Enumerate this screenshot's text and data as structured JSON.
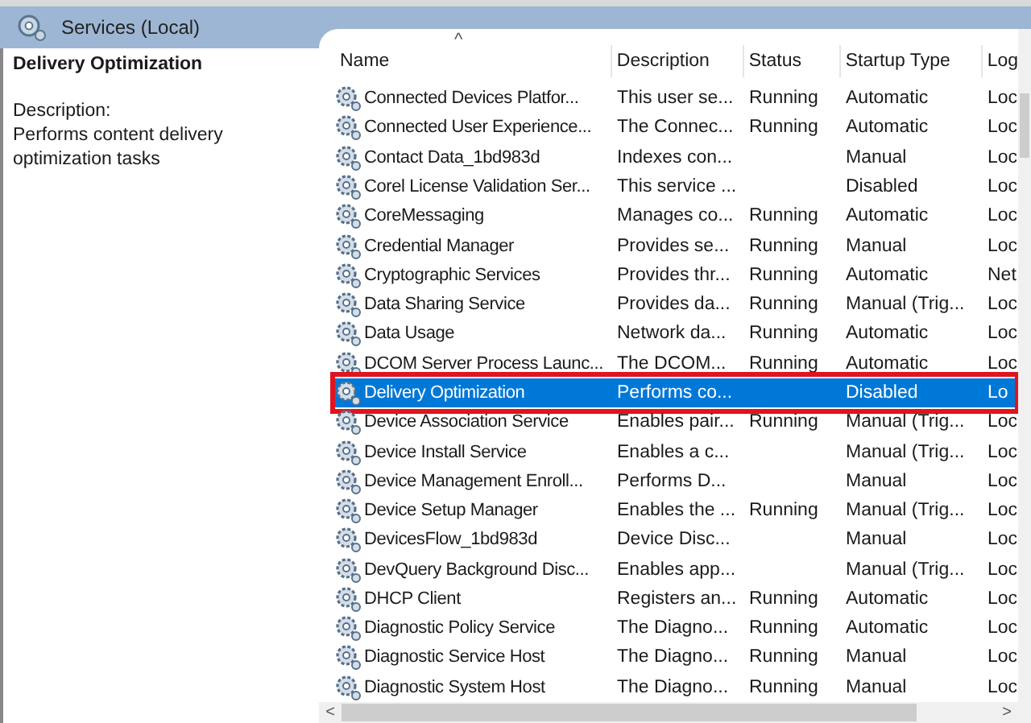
{
  "window": {
    "title": "Services (Local)"
  },
  "details": {
    "name": "Delivery Optimization",
    "description_label": "Description:",
    "description": "Performs content delivery optimization tasks"
  },
  "table": {
    "sort_indicator": "^",
    "columns": [
      "Name",
      "Description",
      "Status",
      "Startup Type",
      "Log"
    ],
    "rows": [
      {
        "name": "Connected Devices Platfor...",
        "description": "This user se...",
        "status": "Running",
        "startup": "Automatic",
        "log": "Loc",
        "selected": false
      },
      {
        "name": "Connected User Experience...",
        "description": "The Connec...",
        "status": "Running",
        "startup": "Automatic",
        "log": "Loc",
        "selected": false
      },
      {
        "name": "Contact Data_1bd983d",
        "description": "Indexes con...",
        "startup": "Manual",
        "log": "Loc",
        "selected": false
      },
      {
        "name": "Corel License Validation Ser...",
        "description": "This service ...",
        "startup": "Disabled",
        "log": "Loc",
        "selected": false
      },
      {
        "name": "CoreMessaging",
        "description": "Manages co...",
        "status": "Running",
        "startup": "Automatic",
        "log": "Loc",
        "selected": false
      },
      {
        "name": "Credential Manager",
        "description": "Provides se...",
        "status": "Running",
        "startup": "Manual",
        "log": "Loc",
        "selected": false
      },
      {
        "name": "Cryptographic Services",
        "description": "Provides thr...",
        "status": "Running",
        "startup": "Automatic",
        "log": "Net",
        "selected": false
      },
      {
        "name": "Data Sharing Service",
        "description": "Provides da...",
        "status": "Running",
        "startup": "Manual (Trig...",
        "log": "Loc",
        "selected": false
      },
      {
        "name": "Data Usage",
        "description": "Network da...",
        "status": "Running",
        "startup": "Automatic",
        "log": "Loc",
        "selected": false
      },
      {
        "name": "DCOM Server Process Launc...",
        "description": "The DCOM...",
        "status": "Running",
        "startup": "Automatic",
        "log": "Loc",
        "selected": false
      },
      {
        "name": "Delivery Optimization",
        "description": "Performs co...",
        "startup": "Disabled",
        "log": "Lo",
        "selected": true
      },
      {
        "name": "Device Association Service",
        "description": "Enables pair...",
        "status": "Running",
        "startup": "Manual (Trig...",
        "log": "Loc",
        "selected": false
      },
      {
        "name": "Device Install Service",
        "description": "Enables a c...",
        "startup": "Manual (Trig...",
        "log": "Loc",
        "selected": false
      },
      {
        "name": "Device Management Enroll...",
        "description": "Performs D...",
        "startup": "Manual",
        "log": "Loc",
        "selected": false
      },
      {
        "name": "Device Setup Manager",
        "description": "Enables the ...",
        "status": "Running",
        "startup": "Manual (Trig...",
        "log": "Loc",
        "selected": false
      },
      {
        "name": "DevicesFlow_1bd983d",
        "description": "Device Disc...",
        "startup": "Manual",
        "log": "Loc",
        "selected": false
      },
      {
        "name": "DevQuery Background Disc...",
        "description": "Enables app...",
        "startup": "Manual (Trig...",
        "log": "Loc",
        "selected": false
      },
      {
        "name": "DHCP Client",
        "description": "Registers an...",
        "status": "Running",
        "startup": "Automatic",
        "log": "Loc",
        "selected": false
      },
      {
        "name": "Diagnostic Policy Service",
        "description": "The Diagno...",
        "status": "Running",
        "startup": "Automatic",
        "log": "Loc",
        "selected": false
      },
      {
        "name": "Diagnostic Service Host",
        "description": "The Diagno...",
        "status": "Running",
        "startup": "Manual",
        "log": "Loc",
        "selected": false
      },
      {
        "name": "Diagnostic System Host",
        "description": "The Diagno...",
        "status": "Running",
        "startup": "Manual",
        "log": "Loc",
        "selected": false
      }
    ]
  },
  "scrollbar": {
    "left": "<",
    "right": ">"
  }
}
